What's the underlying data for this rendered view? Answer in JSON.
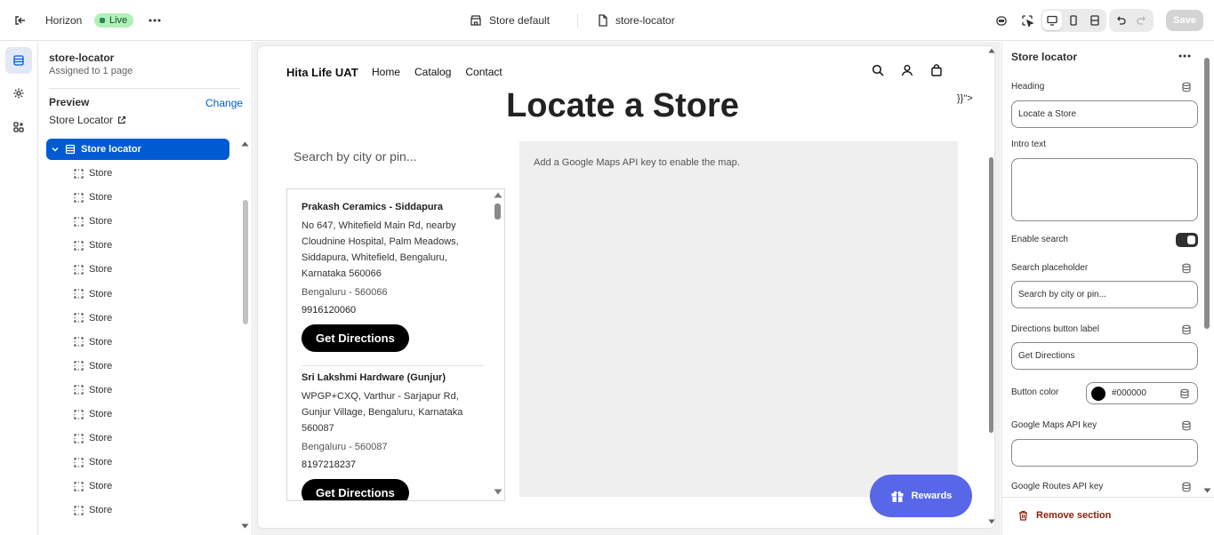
{
  "topbar": {
    "back_icon": "exit-icon",
    "theme_name": "Horizon",
    "live_badge": "Live",
    "template_label": "Store default",
    "page_label": "store-locator",
    "save_label": "Save"
  },
  "left_panel": {
    "title": "store-locator",
    "subtitle": "Assigned to 1 page",
    "preview_label": "Preview",
    "change_label": "Change",
    "preview_page": "Store Locator",
    "selected_section": "Store locator",
    "blocks": [
      "Store",
      "Store",
      "Store",
      "Store",
      "Store",
      "Store",
      "Store",
      "Store",
      "Store",
      "Store",
      "Store",
      "Store",
      "Store",
      "Store",
      "Store"
    ]
  },
  "preview": {
    "store_name": "Hita Life UAT",
    "nav": [
      "Home",
      "Catalog",
      "Contact"
    ],
    "heading": "Locate a Store",
    "stray_text": "}}\">",
    "search_placeholder": "Search by city or pin...",
    "map_message": "Add a Google Maps API key to enable the map.",
    "stores": [
      {
        "name": "Prakash Ceramics - Siddapura",
        "address": "No 647, Whitefield Main Rd, nearby Cloudnine Hospital, Palm Meadows, Siddapura, Whitefield, Bengaluru, Karnataka 560066",
        "city": "Bengaluru - 560066",
        "phone": "9916120060",
        "button": "Get Directions"
      },
      {
        "name": "Sri Lakshmi Hardware (Gunjur)",
        "address": "WPGP+CXQ, Varthur - Sarjapur Rd, Gunjur Village, Bengaluru, Karnataka 560087",
        "city": "Bengaluru - 560087",
        "phone": "8197218237",
        "button": "Get Directions"
      }
    ],
    "rewards_label": "Rewards",
    "rewards_color": "#5867e8"
  },
  "right_panel": {
    "title": "Store locator",
    "heading_label": "Heading",
    "heading_value": "Locate a Store",
    "intro_label": "Intro text",
    "intro_value": "",
    "enable_search_label": "Enable search",
    "enable_search": true,
    "search_placeholder_label": "Search placeholder",
    "search_placeholder_value": "Search by city or pin...",
    "directions_label": "Directions button label",
    "directions_value": "Get Directions",
    "button_color_label": "Button color",
    "button_color_value": "#000000",
    "maps_key_label": "Google Maps API key",
    "maps_key_value": "",
    "routes_key_label": "Google Routes API key",
    "remove_label": "Remove section"
  },
  "colors": {
    "accent": "#005bd3",
    "live_bg": "#aff0b5",
    "danger": "#8e1f0b"
  }
}
